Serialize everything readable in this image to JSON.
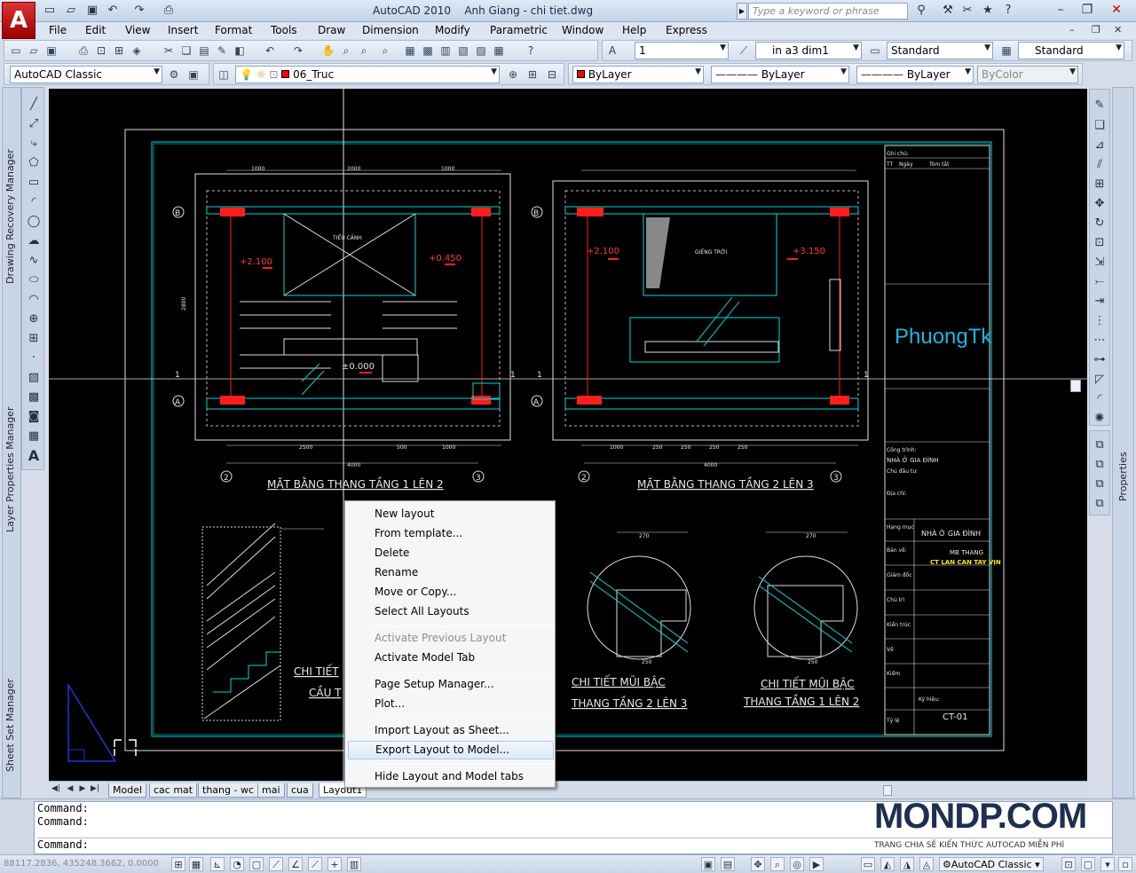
{
  "window": {
    "app_name": "AutoCAD 2010",
    "file_title": "Anh Giang - chi tiet.dwg",
    "search_placeholder": "Type a keyword or phrase"
  },
  "menu": [
    "File",
    "Edit",
    "View",
    "Insert",
    "Format",
    "Tools",
    "Draw",
    "Dimension",
    "Modify",
    "Parametric",
    "Window",
    "Help",
    "Express"
  ],
  "toolbar": {
    "scale_value": "1",
    "dim_style": "in a3 dim1",
    "text_style": "Standard",
    "table_style": "Standard",
    "workspace": "AutoCAD Classic",
    "layer": "06_Truc",
    "color": "ByLayer",
    "linetype": "ByLayer",
    "lineweight": "ByLayer",
    "plotstyle": "ByColor"
  },
  "palettes": {
    "left_top": "Drawing Recovery Manager",
    "left_middle": "Layer Properties Manager",
    "left_bottom": "Sheet Set Manager",
    "right": "Properties"
  },
  "drawing": {
    "plan1_title": "MẶT BẰNG THANG TẦNG 1 LÊN 2",
    "plan2_title": "MẶT BẰNG THANG TẦNG 2 LÊN 3",
    "detail_left_title_1": "CHI TIẾT",
    "detail_left_title_2": "CẦU T",
    "detail_mid_title_1": "CHI TIẾT MŨI BẬC",
    "detail_mid_title_2": "THANG TẦNG 2 LÊN 3",
    "detail_right_title_1": "CHI TIẾT MŨI BẬC",
    "detail_right_title_2": "THANG TẦNG 1 LÊN 2",
    "label_tieu_canh": "TIỂU CẢNH",
    "label_gieng_troi": "GIẾNG TRỜI",
    "level_1": "+2.100",
    "level_2": "+0.450",
    "level_3": "±0.000",
    "level_4": "+2.100",
    "level_5": "+3.150",
    "dim_1000": "1000",
    "dim_2000": "2000",
    "dim_2500": "2500",
    "dim_500": "500",
    "dim_4000": "4000",
    "dim_2800": "2800",
    "dim_270": "270",
    "dim_250": "250",
    "axis_a": "A",
    "axis_b": "B",
    "axis_2": "2",
    "axis_3": "3",
    "axis_1": "1",
    "logo_text": "PhuongTk",
    "title_block": {
      "ghi_chu": "Ghi chú:",
      "col_tt": "TT",
      "col_ngay": "Ngày",
      "col_tomtat": "Tóm tắt",
      "cong_trinh": "Công trình:",
      "cong_trinh_value": "NHÀ Ở GIA ĐÌNH",
      "chu_dau_tu": "Chủ đầu tư:",
      "dia_chi": "Địa chỉ:",
      "hang_muc": "Hạng mục",
      "hang_muc_value": "NHÀ Ở GIA ĐÌNH",
      "ban_ve": "Bản vẽ:",
      "ban_ve_value_1": "MB THANG",
      "ban_ve_value_2": "CT LAN CAN TAY VỊN",
      "giam_doc": "Giám đốc",
      "chu_tri": "Chủ trì",
      "kien_truc": "Kiến trúc",
      "ve": "Vẽ",
      "kiem": "Kiểm",
      "ky_hieu": "Ký hiệu:",
      "sheet_code": "CT-01",
      "ty_le": "Tỷ lệ"
    }
  },
  "layout_tabs": [
    "Model",
    "cac mat",
    "thang - wc",
    "mai",
    "cua",
    "Layout1"
  ],
  "context_menu": {
    "items": [
      {
        "label": "New layout",
        "enabled": true
      },
      {
        "label": "From template...",
        "enabled": true
      },
      {
        "label": "Delete",
        "enabled": true
      },
      {
        "label": "Rename",
        "enabled": true
      },
      {
        "label": "Move or Copy...",
        "enabled": true
      },
      {
        "label": "Select All Layouts",
        "enabled": true
      },
      {
        "label": "Activate Previous Layout",
        "enabled": false
      },
      {
        "label": "Activate Model Tab",
        "enabled": true
      },
      {
        "label": "Page Setup Manager...",
        "enabled": true
      },
      {
        "label": "Plot...",
        "enabled": true
      },
      {
        "label": "Import Layout as Sheet...",
        "enabled": true
      },
      {
        "label": "Export Layout to Model...",
        "enabled": true,
        "highlighted": true
      },
      {
        "label": "Hide Layout and Model tabs",
        "enabled": true
      }
    ]
  },
  "command_lines": [
    "Command:",
    "Command:",
    "Command:"
  ],
  "status": {
    "coordinates": "88117.2836, 435248.3662, 0.0000",
    "workspace": "AutoCAD Classic"
  },
  "watermark": {
    "brand": "MONDP.COM",
    "tagline": "TRANG CHIA SẺ KIẾN THỨC AUTOCAD MIỄN PHÍ"
  }
}
